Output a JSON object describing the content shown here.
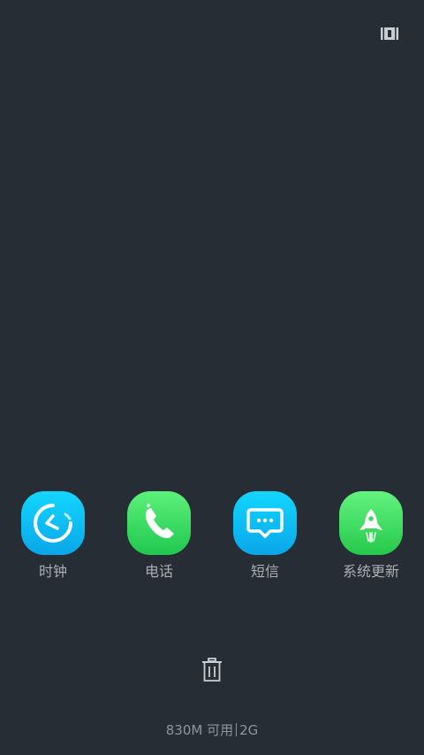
{
  "recents": {
    "apps": [
      {
        "label": "时钟",
        "icon": "clock-icon",
        "color": "#16c6f4"
      },
      {
        "label": "电话",
        "icon": "phone-icon",
        "color": "#3fe06a"
      },
      {
        "label": "短信",
        "icon": "message-icon",
        "color": "#16c6f4"
      },
      {
        "label": "系统更新",
        "icon": "rocket-icon",
        "color": "#47e068"
      }
    ],
    "clear_icon": "trash-icon",
    "toggle_icon": "layout-toggle-icon",
    "memory": {
      "available": "830M 可用",
      "total": "2G"
    }
  }
}
